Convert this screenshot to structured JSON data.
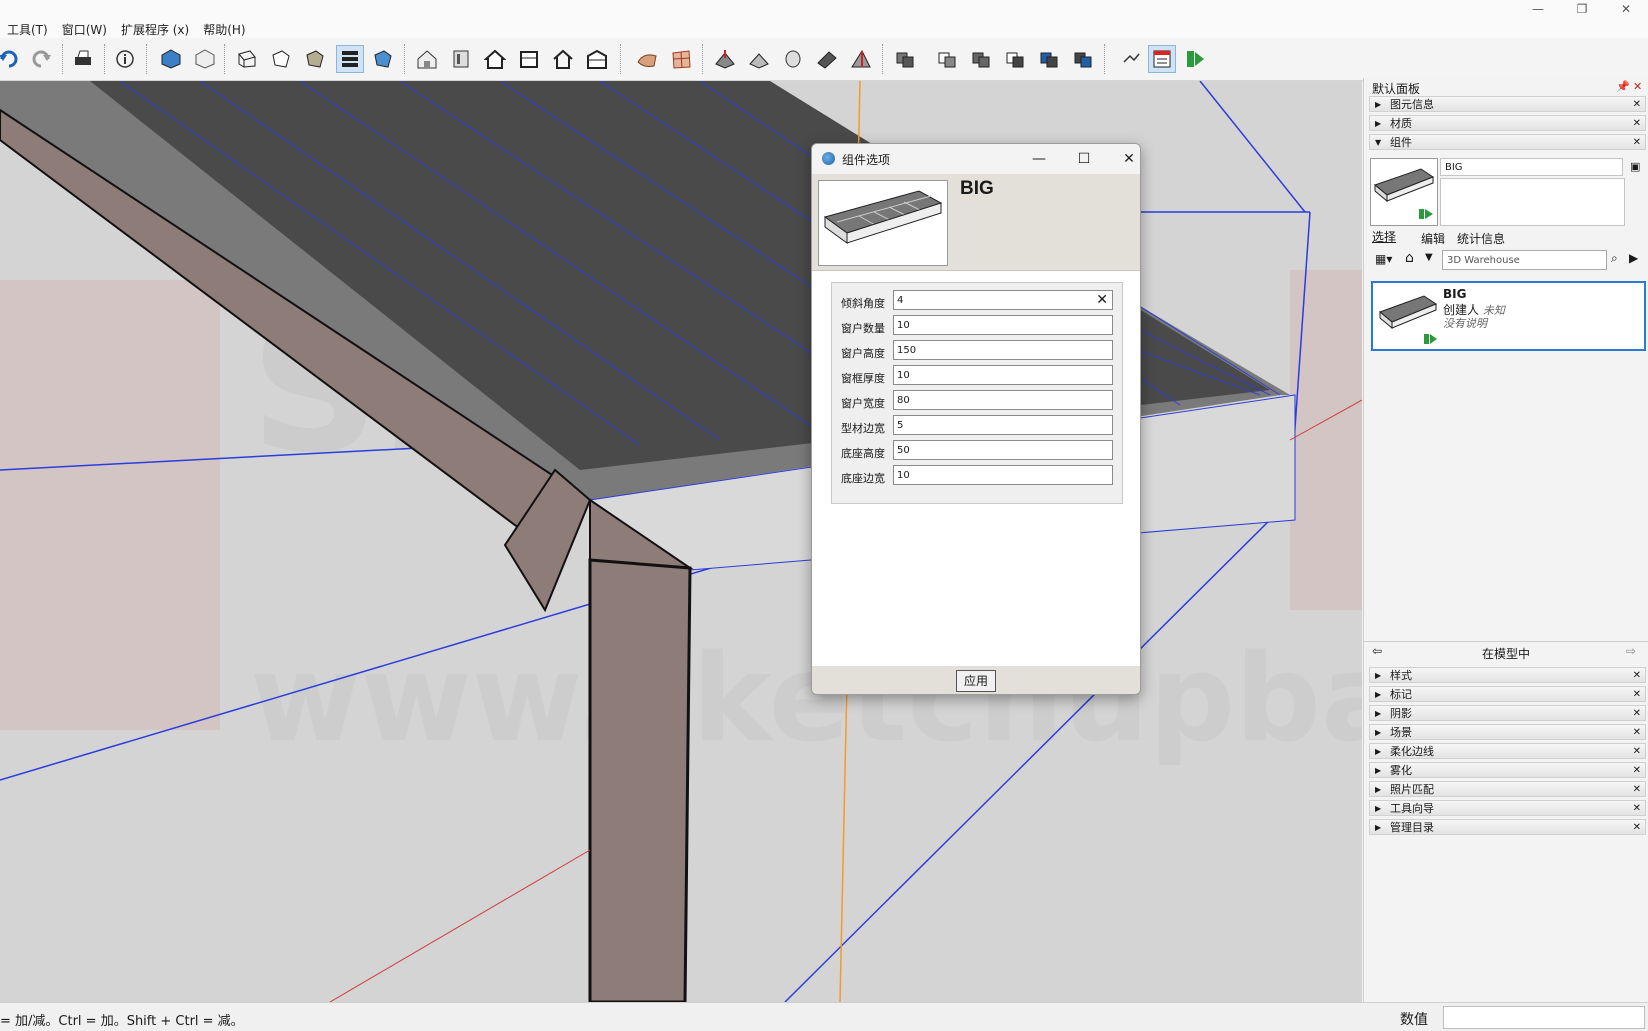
{
  "menubar": {
    "items": [
      "工具(T)",
      "窗口(W)",
      "扩展程序 (x)",
      "帮助(H)"
    ],
    "window_controls": [
      "minimize-icon",
      "restore-icon",
      "close-icon"
    ]
  },
  "toolbar": {
    "icons": [
      "undo-icon",
      "redo-icon",
      "print-icon",
      "model-info-icon",
      "iso-view-icon",
      "xray-view-icon",
      "wireframe-style-icon",
      "hidden-line-style-icon",
      "shaded-style-icon",
      "textured-style-icon",
      "monochrome-style-icon",
      "3d-warehouse-icon",
      "extension-icon",
      "front-view-icon",
      "top-view-icon",
      "home-view-icon",
      "left-view-icon",
      "back-view-icon",
      "sandbox-from-contours-icon",
      "sandbox-from-scratch-icon",
      "smoove-icon",
      "stamp-icon",
      "drape-icon",
      "add-detail-icon",
      "flip-edge-icon",
      "outer-shell-icon",
      "intersect-icon",
      "union-icon",
      "subtract-icon",
      "trim-icon",
      "split-icon",
      "follow-me-icon",
      "component-options-icon",
      "run-icon"
    ]
  },
  "dialog": {
    "title": "组件选项",
    "component_name": "BIG",
    "fields": [
      {
        "label": "倾斜角度",
        "value": "4"
      },
      {
        "label": "窗户数量",
        "value": "10"
      },
      {
        "label": "窗户高度",
        "value": "150"
      },
      {
        "label": "窗框厚度",
        "value": "10"
      },
      {
        "label": "窗户宽度",
        "value": "80"
      },
      {
        "label": "型材边宽",
        "value": "5"
      },
      {
        "label": "底座高度",
        "value": "50"
      },
      {
        "label": "底座边宽",
        "value": "10"
      }
    ],
    "apply_label": "应用"
  },
  "panel": {
    "title": "默认面板",
    "top_trays": [
      "图元信息",
      "材质",
      "组件"
    ],
    "component_name": "BIG",
    "tabs": [
      "选择",
      "编辑",
      "统计信息"
    ],
    "search_placeholder": "3D Warehouse",
    "result": {
      "name": "BIG",
      "creator_label": "创建人",
      "creator": "未知",
      "description": "没有说明"
    },
    "in_model": "在模型中",
    "bottom_trays": [
      "样式",
      "标记",
      "阴影",
      "场景",
      "柔化边线",
      "雾化",
      "照片匹配",
      "工具向导",
      "管理目录"
    ]
  },
  "status": {
    "hint": "= 加/减。Ctrl = 加。Shift + Ctrl = 减。",
    "measure_label": "数值",
    "measure_value": ""
  },
  "colors": {
    "selection_blue": "#2a3ddd",
    "axis_green": "#c35a2a",
    "column_brown": "#8e7c78",
    "accent": "#2a7ad2"
  }
}
